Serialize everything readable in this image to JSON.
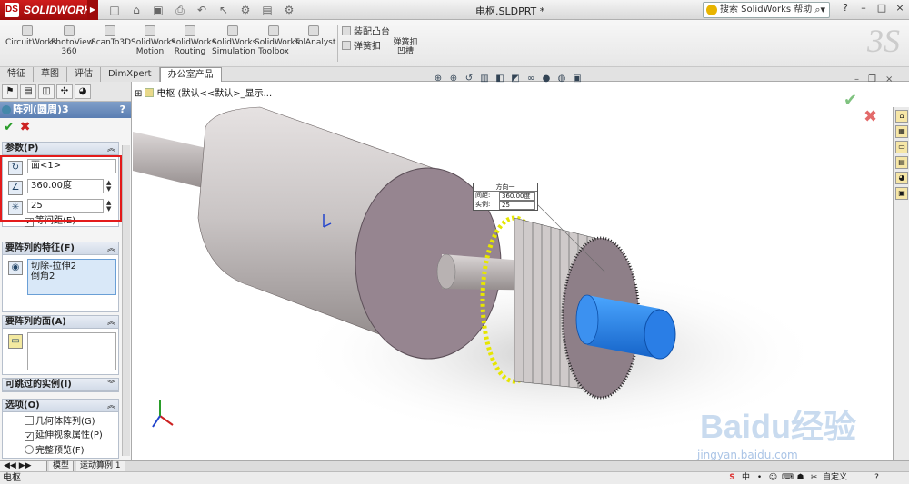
{
  "app": {
    "brand": "SOLIDWORKS",
    "document_title": "电枢.SLDPRT *",
    "search_placeholder": "搜索 SolidWorks 帮助",
    "window_buttons": [
      "?",
      "–",
      "□",
      "×"
    ]
  },
  "commands": {
    "large": [
      {
        "label": "CircuitWorks"
      },
      {
        "label": "PhotoView 360"
      },
      {
        "label": "ScanTo3D"
      },
      {
        "label": "SolidWorks Motion"
      },
      {
        "label": "SolidWorks Routing"
      },
      {
        "label": "SolidWorks Simulation"
      },
      {
        "label": "SolidWorks Toolbox"
      },
      {
        "label": "TolAnalyst"
      }
    ],
    "small": [
      "装配凸台",
      "弹簧扣",
      "弹簧扣 凹槽"
    ]
  },
  "tabs": [
    "特征",
    "草图",
    "评估",
    "DimXpert",
    "办公室产品"
  ],
  "active_tab": "办公室产品",
  "property_manager": {
    "title": "阵列(圆周)3",
    "help": "?",
    "groups": {
      "parameters": {
        "title": "参数(P)",
        "axis": "面<1>",
        "angle": "360.00度",
        "instances": "25",
        "equal_spacing": "等间距(E)",
        "equal_spacing_checked": true
      },
      "features": {
        "title": "要阵列的特征(F)",
        "items": [
          "切除-拉伸2",
          "倒角2"
        ]
      },
      "faces": {
        "title": "要阵列的面(A)"
      },
      "skip": {
        "title": "可跳过的实例(I)"
      },
      "options": {
        "title": "选项(O)",
        "geometry_pattern": "几何体阵列(G)",
        "geometry_pattern_checked": false,
        "propagate": "延伸视象属性(P)",
        "propagate_checked": true,
        "full_preview": "完整预览(F)"
      }
    }
  },
  "tree": {
    "root": "电枢 (默认<<默认>_显示..."
  },
  "callout": {
    "title": "方向一",
    "spacing_label": "间距:",
    "spacing_value": "360.00度",
    "instances_label": "实例:",
    "instances_value": "25"
  },
  "bottom_tabs": [
    "模型",
    "运动算例 1"
  ],
  "status": {
    "left": "电枢",
    "tray_text": "自定义"
  },
  "watermark": {
    "main": "Baidu经验",
    "sub": "jingyan.baidu.com"
  }
}
